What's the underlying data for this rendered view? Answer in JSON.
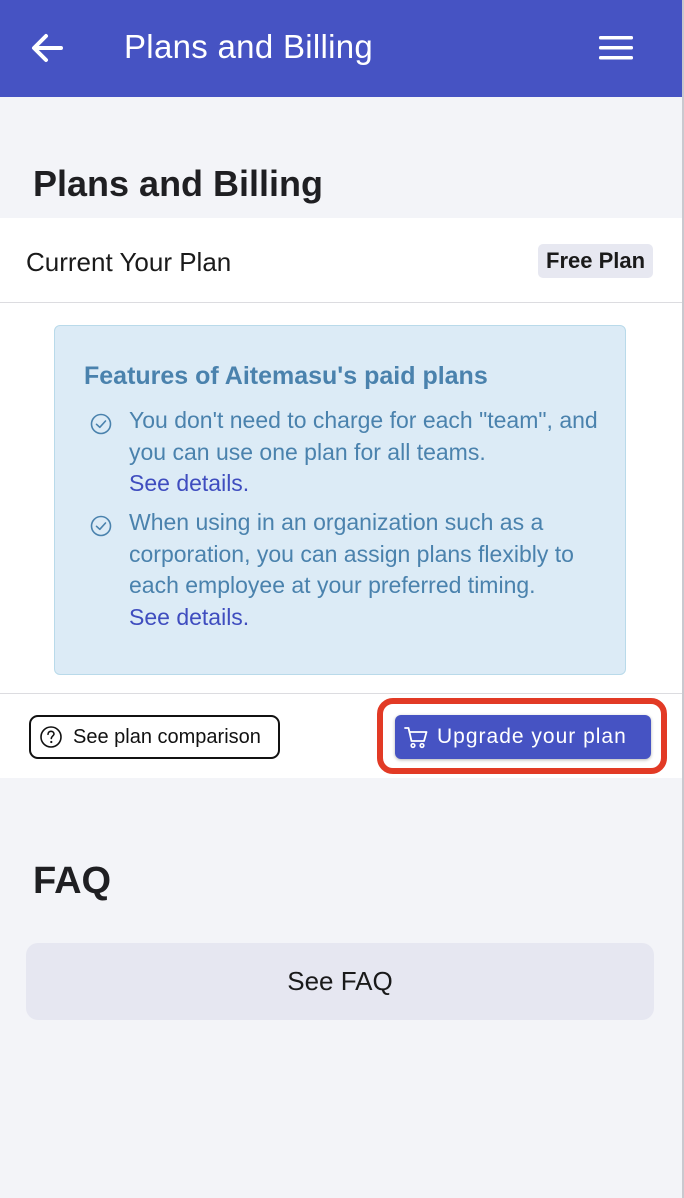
{
  "header": {
    "title": "Plans and Billing",
    "back_icon": "arrow-left-icon",
    "menu_icon": "hamburger-menu-icon",
    "color": "#4653c3"
  },
  "page": {
    "title": "Plans and Billing"
  },
  "plan": {
    "label": "Current Your Plan",
    "badge": "Free Plan"
  },
  "features": {
    "title": "Features of Aitemasu's paid plans",
    "items": [
      {
        "text": "You don't need to charge for each \"team\", and you can use one plan for all teams.",
        "link": "See details."
      },
      {
        "text": "When using in an organization such as a corporation, you can assign plans flexibly to each employee at your preferred timing.",
        "link": "See details."
      }
    ]
  },
  "actions": {
    "compare_label": "See plan comparison",
    "upgrade_label": "Upgrade your plan",
    "highlight_color": "#e23a25"
  },
  "faq": {
    "title": "FAQ",
    "button_label": "See FAQ"
  }
}
